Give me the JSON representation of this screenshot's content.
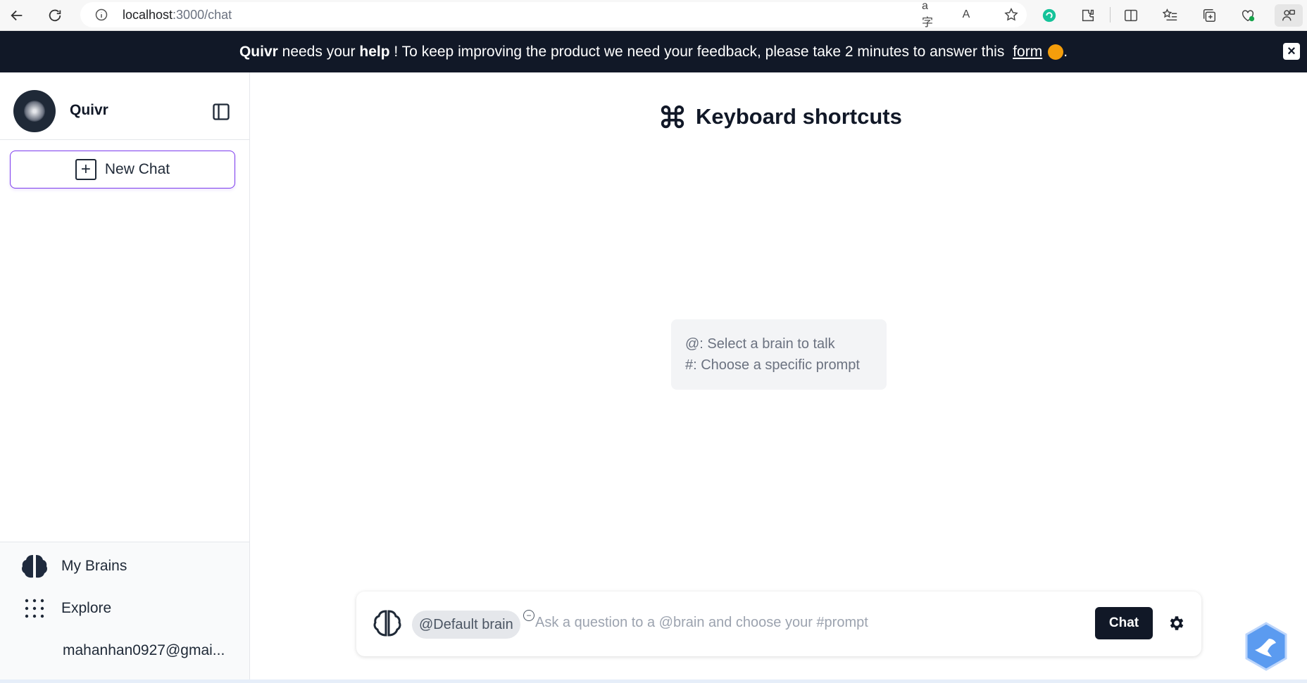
{
  "browser": {
    "url_host": "localhost",
    "url_path": ":3000/chat"
  },
  "banner": {
    "brand": "Quivr",
    "text1": " needs your ",
    "help": "help",
    "text2": " ! To keep improving the product we need your feedback, please take 2 minutes to answer this ",
    "link": "form",
    "end": "."
  },
  "sidebar": {
    "brand": "Quivr",
    "new_chat": "New Chat",
    "footer": {
      "my_brains": "My Brains",
      "explore": "Explore",
      "user_email": "mahanhan0927@gmai..."
    }
  },
  "main": {
    "title": "Keyboard shortcuts",
    "hints": [
      "@: Select a brain to talk",
      "#: Choose a specific prompt"
    ],
    "chat": {
      "brain_tag": "@Default brain",
      "placeholder": "Ask a question to a @brain and choose your #prompt",
      "send": "Chat"
    }
  },
  "colors": {
    "banner_bg": "#111827",
    "accent": "#7c3aed",
    "chat_button": "#111827"
  }
}
